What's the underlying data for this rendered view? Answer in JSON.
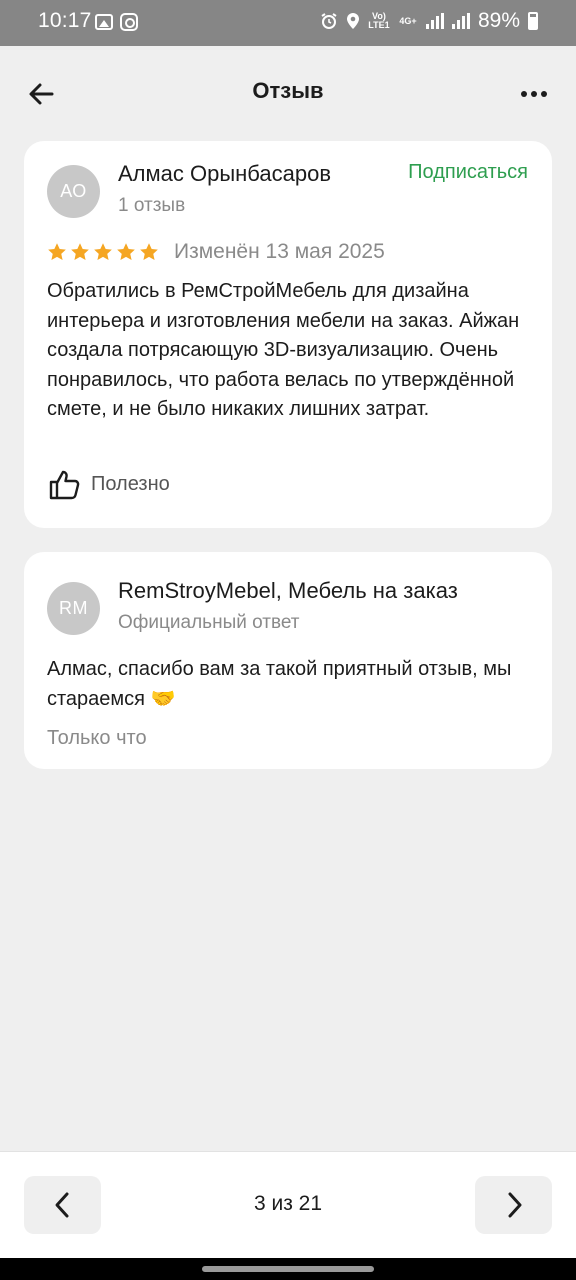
{
  "status_bar": {
    "time": "10:17",
    "network_label": "Vo) LTE1",
    "network_type": "4G+",
    "battery": "89%"
  },
  "header": {
    "title": "Отзыв",
    "back_icon": "arrow-left-icon",
    "more_icon": "more-horizontal-icon"
  },
  "review": {
    "avatar_initials": "АО",
    "author": "Алмас Орынбасаров",
    "reviews_count": "1 отзыв",
    "subscribe_label": "Подписаться",
    "rating": 5,
    "rating_max": 5,
    "date": "Изменён 13 мая 2025",
    "text": "Обратились в РемСтройМебель для дизайна интерьера и изготовления мебели на заказ. Айжан создала потрясающую 3D-визуализацию. Очень понравилось, что работа велась по утверждённой смете, и не было никаких лишних затрат.",
    "useful_label": "Полезно"
  },
  "reply": {
    "avatar_initials": "RM",
    "author": "RemStroyMebel, Мебель на заказ",
    "subtitle": "Официальный ответ",
    "text": "Алмас, спасибо вам за такой приятный отзыв, мы стараемся 🤝",
    "time": "Только что"
  },
  "pager": {
    "counter": "3 из 21"
  },
  "colors": {
    "accent_green": "#2e9e4f",
    "star": "#f5a623",
    "background": "#efefef"
  }
}
